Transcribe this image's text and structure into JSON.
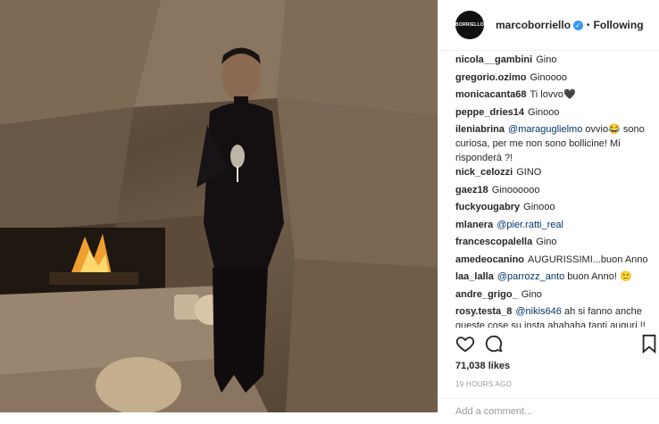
{
  "post": {
    "username": "marcoborriello",
    "avatar_text": "BORRIELLO",
    "following_label": "Following",
    "likes": "71,038 likes",
    "time": "19 HOURS AGO",
    "add_comment_placeholder": "Add a comment..."
  },
  "comments": [
    {
      "user": "nicola__gambini",
      "text": "Gino"
    },
    {
      "user": "gregorio.ozimo",
      "text": "Ginoooo"
    },
    {
      "user": "monicacanta68",
      "text": "Ti lovvo🖤"
    },
    {
      "user": "peppe_dries14",
      "text": "Ginooo"
    },
    {
      "user": "ileniabrina",
      "mention": "@maraguglielmo",
      "text": "ovvio😂 sono curiosa, per me non sono bollicine! Mi risponderà ?!"
    },
    {
      "user": "nick_celozzi",
      "text": "GINO"
    },
    {
      "user": "gaez18",
      "text": "Ginoooooo"
    },
    {
      "user": "fuckyougabry",
      "text": "Ginooo"
    },
    {
      "user": "mlanera",
      "mention": "@pier.ratti_real",
      "text": ""
    },
    {
      "user": "francescopalella",
      "text": "Gino"
    },
    {
      "user": "amedeocanino",
      "text": "AUGURISSIMI...buon Anno"
    },
    {
      "user": "laa_lalla",
      "mention": "@parrozz_anto",
      "text": "buon Anno! 🙂"
    },
    {
      "user": "andre_grigo_",
      "text": "Gino"
    },
    {
      "user": "rosy.testa_8",
      "mention": "@nikis646",
      "text": "ah si fanno anche queste cose su insta ahahaha tanti auguri !!"
    }
  ],
  "icons": [
    "heart-icon",
    "comment-icon",
    "bookmark-icon",
    "verified-badge-icon"
  ]
}
